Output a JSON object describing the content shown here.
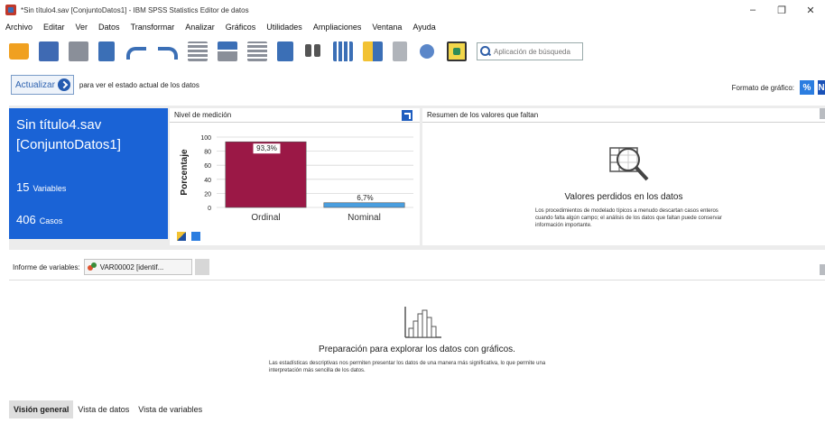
{
  "window": {
    "title": "*Sin título4.sav [ConjuntoDatos1] - IBM SPSS Statistics Editor de datos",
    "minimize": "–",
    "restore": "❐",
    "close": "✕"
  },
  "menu": {
    "items": [
      "Archivo",
      "Editar",
      "Ver",
      "Datos",
      "Transformar",
      "Analizar",
      "Gráficos",
      "Utilidades",
      "Ampliaciones",
      "Ventana",
      "Ayuda"
    ]
  },
  "toolbar": {
    "icons": [
      "open-icon",
      "save-icon",
      "print-icon",
      "recall-dialog-icon",
      "undo-icon",
      "redo-icon",
      "goto-case-icon",
      "goto-variable-icon",
      "variables-icon",
      "find-icon",
      "split-file-icon",
      "weight-cases-icon",
      "select-cases-icon",
      "value-labels-icon",
      "variable-sets-icon"
    ],
    "search_placeholder": "Aplicación de búsqueda"
  },
  "refresh": {
    "button_label": "Actualizar",
    "hint": "para ver el estado actual de los datos"
  },
  "chart_format": {
    "label": "Formato de gráfico:",
    "percent_label": "%",
    "count_label": "N"
  },
  "dataset_card": {
    "title": "Sin título4.sav [ConjuntoDatos1]",
    "variables_count": "15",
    "variables_label": "Variables",
    "cases_count": "406",
    "cases_label": "Casos",
    "color": "#1a63d6"
  },
  "measure_panel": {
    "header": "Nivel de medición"
  },
  "chart_data": {
    "type": "bar",
    "title": "",
    "xlabel": "",
    "ylabel": "Porcentaje",
    "ylim": [
      0,
      100
    ],
    "yticks": [
      0,
      20,
      40,
      60,
      80,
      100
    ],
    "categories": [
      "Ordinal",
      "Nominal"
    ],
    "values": [
      93.3,
      6.7
    ],
    "data_labels": [
      "93,3%",
      "6,7%"
    ],
    "colors": [
      "#9b1846",
      "#4a9fe0"
    ],
    "grid": true
  },
  "missing_panel": {
    "header": "Resumen de los valores que faltan",
    "title": "Valores perdidos en los datos",
    "description": "Los procedimientos de modelado típicos a menudo descartan casos enteros cuando falta algún campo; el análisis de los datos que faltan puede conservar información importante."
  },
  "variable_report": {
    "label": "Informe de variables:",
    "selected": "VAR00002 [identif..."
  },
  "explore": {
    "title": "Preparación para explorar los datos con gráficos.",
    "description": "Las estadísticas descriptivas nos permiten presentar los datos de una manera más significativa, lo que permite una interpretación más sencilla de los datos."
  },
  "tabs": [
    "Visión general",
    "Vista de datos",
    "Vista de variables"
  ],
  "colors": {
    "accent": "#1a63d6",
    "ordinal_bar": "#9b1846",
    "nominal_bar": "#4a9fe0"
  }
}
